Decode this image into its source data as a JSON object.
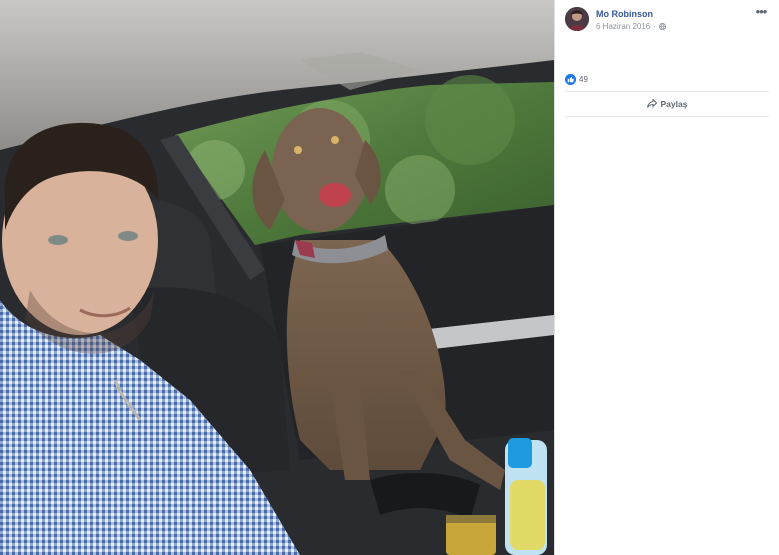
{
  "post": {
    "author": "Mo Robinson",
    "date": "6 Haziran 2016",
    "privacy_icon": "globe-icon",
    "more_label": "•••",
    "photo_description_icon": "photo"
  },
  "reactions": {
    "icon": "like-icon",
    "count": "49"
  },
  "actions": {
    "share_label": "Paylaş",
    "share_icon": "share-arrow-icon"
  },
  "colors": {
    "author_link": "#385898",
    "muted_text": "#90949c",
    "like_blue": "#1877f2",
    "divider": "#e4e6eb"
  }
}
